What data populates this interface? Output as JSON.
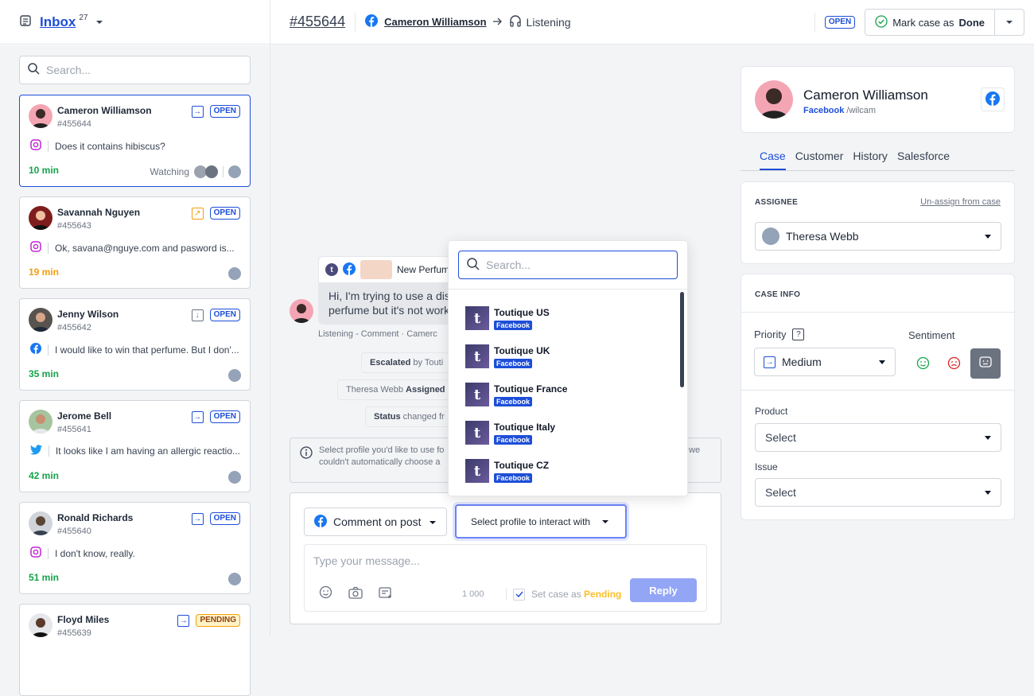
{
  "sidebar": {
    "title": "Inbox",
    "count": "27",
    "search_placeholder": "Search...",
    "cards": [
      {
        "name": "Cameron Williamson",
        "id": "#455644",
        "status": "OPEN",
        "msg": "Does it contains hibiscus?",
        "time": "10 min",
        "extra": "Watching",
        "channel": "instagram",
        "dir": "→"
      },
      {
        "name": "Savannah Nguyen",
        "id": "#455643",
        "status": "OPEN",
        "msg": "Ok, savana@nguye.com and pasword is...",
        "time": "19 min",
        "channel": "instagram",
        "dir": "↗"
      },
      {
        "name": "Jenny Wilson",
        "id": "#455642",
        "status": "OPEN",
        "msg": "I would like to win that perfume. But I don'...",
        "time": "35 min",
        "channel": "facebook",
        "dir": "↓"
      },
      {
        "name": "Jerome Bell",
        "id": "#455641",
        "status": "OPEN",
        "msg": "It looks like I am having an allergic reactio...",
        "time": "42 min",
        "channel": "twitter",
        "dir": "→"
      },
      {
        "name": "Ronald Richards",
        "id": "#455640",
        "status": "OPEN",
        "msg": "I don't know, really.",
        "time": "51 min",
        "channel": "instagram",
        "dir": "→"
      },
      {
        "name": "Floyd Miles",
        "id": "#455639",
        "status": "PENDING",
        "dir": "→"
      }
    ]
  },
  "topbar": {
    "case_id": "#455644",
    "name": "Cameron Williamson",
    "channel": "Listening",
    "status": "OPEN",
    "done_prefix": "Mark case as",
    "done_bold": "Done"
  },
  "conversation": {
    "post_title": "New Perfum",
    "post_text_1": "Hi, I'm trying to use a dis",
    "post_text_2": "perfume but it's not work",
    "meta": "Listening - Comment · Camerc",
    "event1_bold": "Escalated",
    "event1_rest": " by Touti",
    "event2_pre": "Theresa Webb ",
    "event2_bold": "Assigned",
    "event3_bold": "Status",
    "event3_rest": " changed fr",
    "notice_1": "Select profile you'd like to use fo",
    "notice_1b": "we",
    "notice_2": "couldn't automatically choose a"
  },
  "composer": {
    "type_label": "Comment on post",
    "profile_label": "Select profile to interact with",
    "placeholder": "Type your message...",
    "counter": "1 000",
    "pending_prefix": "Set case as",
    "pending_word": "Pending",
    "reply": "Reply"
  },
  "dropdown": {
    "search_placeholder": "Search...",
    "items": [
      {
        "name": "Toutique US",
        "tag": "Facebook"
      },
      {
        "name": "Toutique UK",
        "tag": "Facebook"
      },
      {
        "name": "Toutique France",
        "tag": "Facebook"
      },
      {
        "name": "Toutique Italy",
        "tag": "Facebook"
      },
      {
        "name": "Toutique CZ",
        "tag": "Facebook"
      }
    ]
  },
  "profile": {
    "name": "Cameron Williamson",
    "source": "Facebook",
    "handle": "/wilcam"
  },
  "tabs": [
    "Case",
    "Customer",
    "History",
    "Salesforce"
  ],
  "assignee": {
    "title": "ASSIGNEE",
    "unassign": "Un-assign from case",
    "name": "Theresa Webb"
  },
  "case_info": {
    "title": "CASE INFO",
    "priority_label": "Priority",
    "priority_value": "Medium",
    "sentiment_label": "Sentiment",
    "product_label": "Product",
    "product_value": "Select",
    "issue_label": "Issue",
    "issue_value": "Select"
  },
  "colors": {
    "accent": "#1d4ed8",
    "green": "#16a34a",
    "orange": "#f59e0b"
  }
}
